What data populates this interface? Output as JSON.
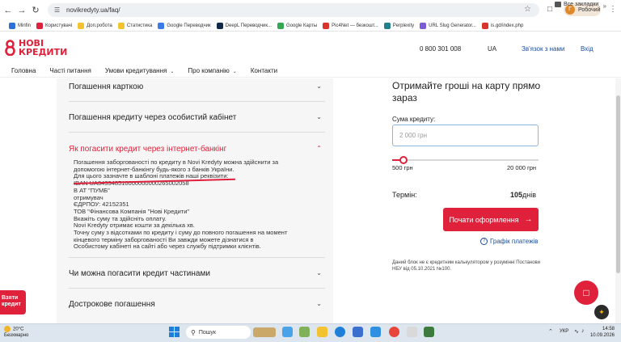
{
  "browser": {
    "url": "novikredyty.ua/faq/",
    "profile_initial": "Г",
    "profile_label": "Робочий"
  },
  "bookmarks": [
    {
      "label": "Minfin",
      "color": "#2f6fd6"
    },
    {
      "label": "Користувачі",
      "color": "#e0213b"
    },
    {
      "label": "Доп.робота",
      "color": "#f2c230"
    },
    {
      "label": "Статистика",
      "color": "#f2c230"
    },
    {
      "label": "Google Переводчик",
      "color": "#3b7be8"
    },
    {
      "label": "DeepL Переводчик...",
      "color": "#0f2b46"
    },
    {
      "label": "Google Карты",
      "color": "#34a853"
    },
    {
      "label": "Pic4Net — безкошт...",
      "color": "#d8342b"
    },
    {
      "label": "Perplexity",
      "color": "#20808d"
    },
    {
      "label": "URL Slug Generator...",
      "color": "#7a5cd6"
    },
    {
      "label": "is.gd/index.php",
      "color": "#d8342b"
    }
  ],
  "bookmarks_all": "Все закладки",
  "site": {
    "logo_line1": "НОВІ",
    "logo_line2": "КРЕДИТИ",
    "phone": "0 800 301 008",
    "lang": "UA",
    "contact": "Зв'язок з нами",
    "login": "Вхід"
  },
  "menu": [
    {
      "label": "Головна",
      "dropdown": false
    },
    {
      "label": "Часті питання",
      "dropdown": false
    },
    {
      "label": "Умови кредитування",
      "dropdown": true
    },
    {
      "label": "Про компанію",
      "dropdown": true
    },
    {
      "label": "Контакти",
      "dropdown": false
    }
  ],
  "faq": {
    "q1": "Погашення карткою",
    "q2": "Погашення кредиту через особистий кабінет",
    "q3": "Як погасити кредит через інтернет-банкінг",
    "q4": "Чи можна погасити кредит частинами",
    "q5": "Дострокове погашення",
    "answer_lines": [
      "Погашення заборгованості по кредиту в Novi Kredyty можна здійснити за",
      "допомогою інтернет-банкінгу будь-якого з банків України.",
      "Для цього зазначте в шаблоні платежів наші реквізити:",
      "IBAN UA343348510000000000265002058",
      "В АТ \"ПУМБ\"",
      "отримувач",
      "ЄДРПОУ: 42152351",
      "ТОВ \"Фінансова Компанія \"Нові Кредити\"",
      "Вкажіть суму та здійсніть оплату.",
      "Novi Kredyty отримає кошти за декілька хв.",
      "Точну суму з відсотками по кредиту і суму до повного погашення на момент",
      "кінцевого терміну заборгованості Ви завжди можете дізнатися в",
      "Особистому кабінеті на сайті або через службу підтримки клієнтів."
    ]
  },
  "calc": {
    "title": "Отримайте гроші на карту прямо зараз",
    "amount_label": "Сума кредиту:",
    "amount_placeholder": "2 000 грн",
    "slider_min": "500 грн",
    "slider_max": "20 000 грн",
    "slider_fraction": 0.08,
    "term_label": "Термін:",
    "term_value": "105",
    "term_unit": "днів",
    "cta": "Почати оформлення",
    "schedule": "Графік платежів",
    "disclaimer": "Даний блок не є кредитним калькулятором у розумінні Постанови НБУ від 05.10.2021 №100."
  },
  "floating": {
    "take_credit": "Взяти кредит"
  },
  "taskbar": {
    "temp": "20°C",
    "weather": "Безхмарно",
    "search": "Пошук",
    "lang": "УКР",
    "time": "14:58",
    "date": "10.09.2026"
  },
  "colors": {
    "brand": "#e0213b",
    "link": "#1a4c9a"
  }
}
